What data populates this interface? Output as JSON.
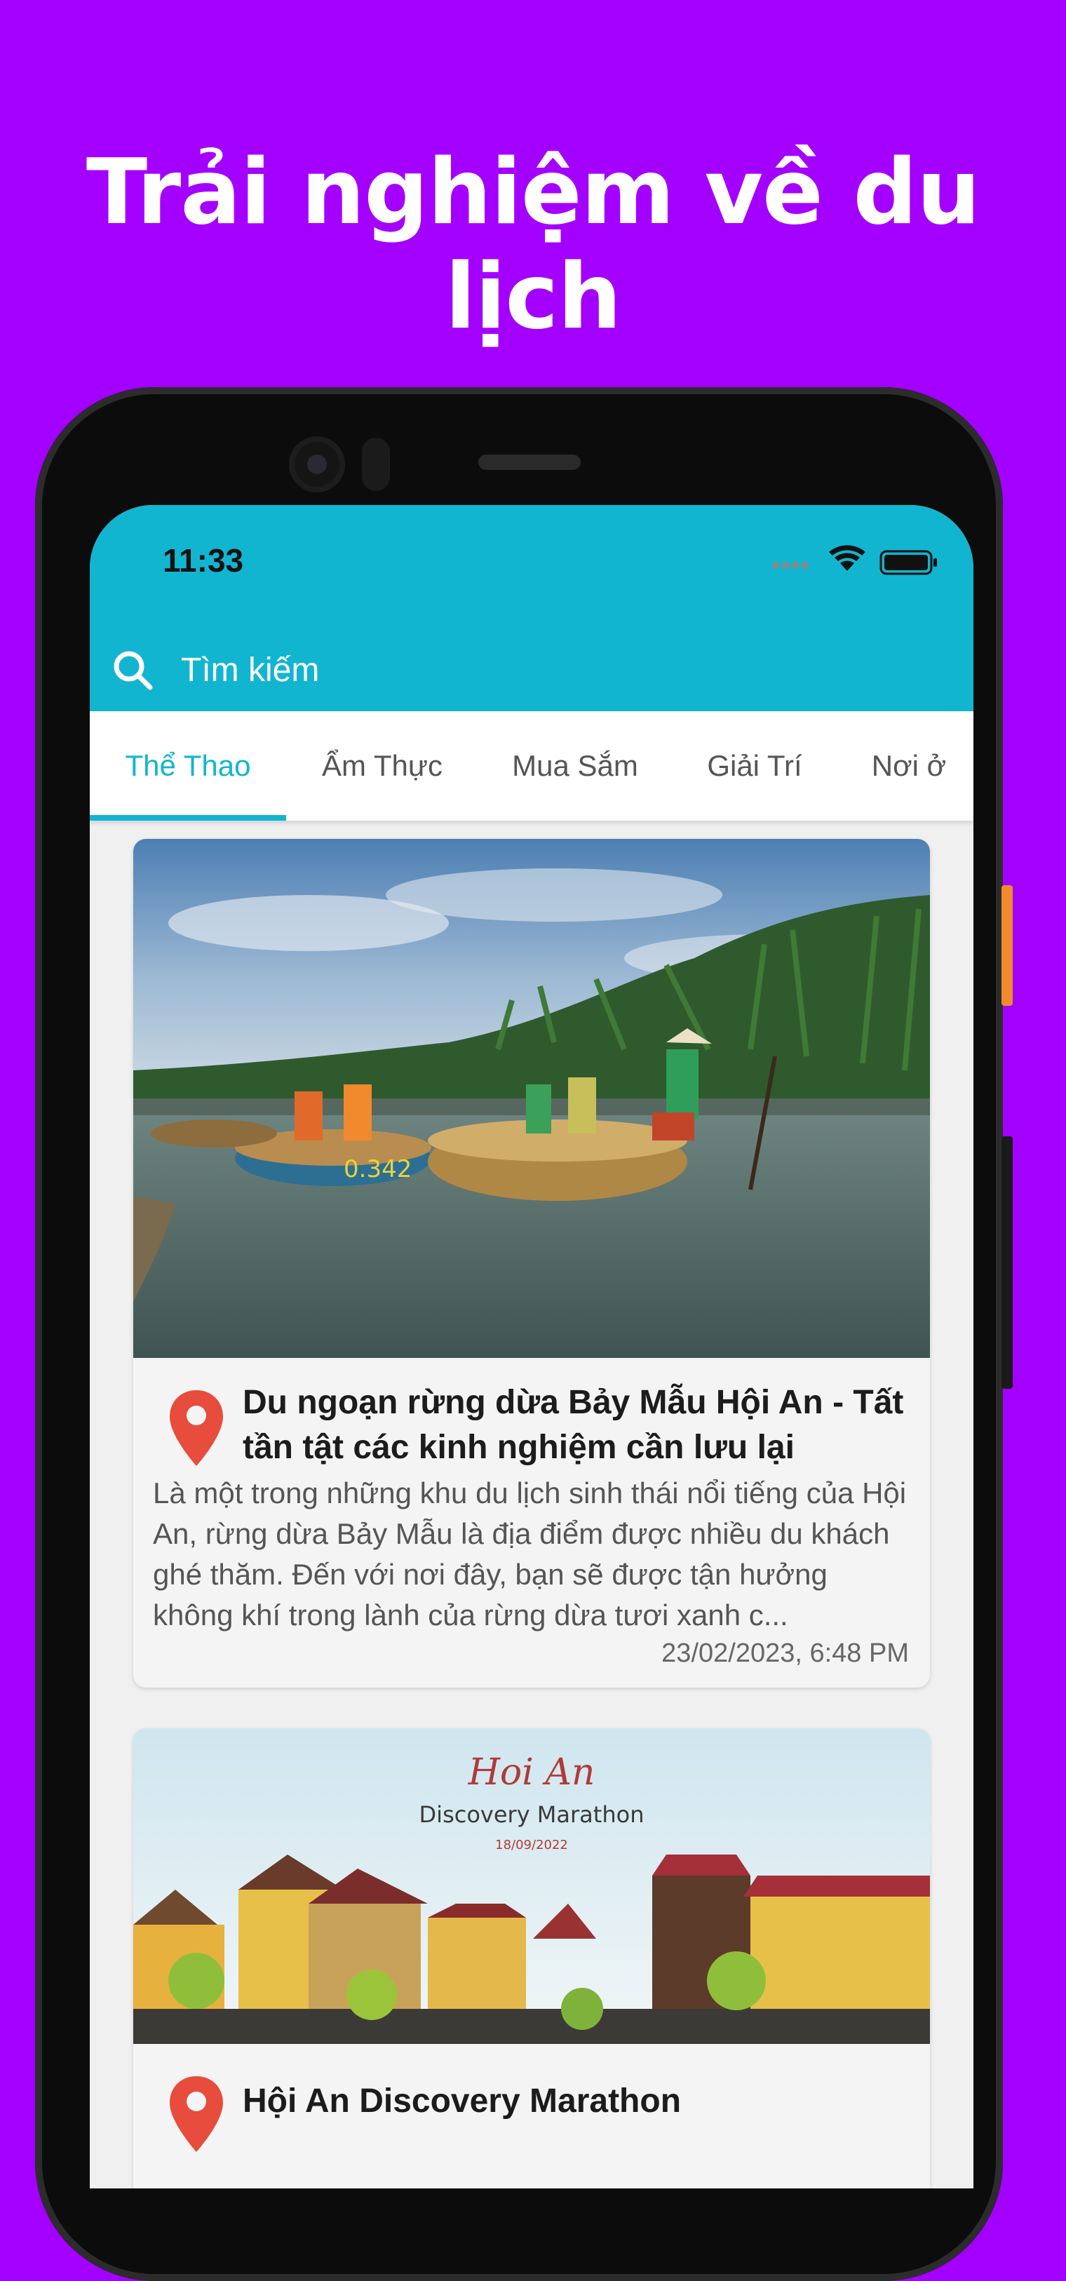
{
  "headline": "Trải nghiệm về du lịch",
  "status": {
    "time": "11:33",
    "icons": [
      "signal-dots-icon",
      "wifi-icon",
      "battery-icon"
    ]
  },
  "search": {
    "placeholder": "Tìm kiếm",
    "icon": "search-icon"
  },
  "tabs": [
    {
      "label": "Thể Thao",
      "active": true
    },
    {
      "label": "Ẩm Thực",
      "active": false
    },
    {
      "label": "Mua Sắm",
      "active": false
    },
    {
      "label": "Giải Trí",
      "active": false
    },
    {
      "label": "Nơi ở",
      "active": false
    }
  ],
  "articles": [
    {
      "title": "Du ngoạn rừng dừa Bảy Mẫu Hội An - Tất tần tật các kinh nghiệm cần lưu lại",
      "description": "Là một trong những khu du lịch sinh thái nổi tiếng của Hội An, rừng dừa Bảy Mẫu là địa điểm được nhiều du khách ghé thăm. Đến với nơi đây, bạn sẽ được tận hưởng không khí trong lành của rừng dừa tươi xanh c...",
      "date": "23/02/2023, 6:48 PM",
      "boat_number": "0.342"
    },
    {
      "title": "Hội An Discovery Marathon",
      "banner_script": "Hoi An",
      "banner_title": "Discovery Marathon",
      "banner_date": "18/09/2022"
    }
  ],
  "colors": {
    "background": "#a400ff",
    "accent": "#12b5d0",
    "pin": "#e74c3c"
  }
}
